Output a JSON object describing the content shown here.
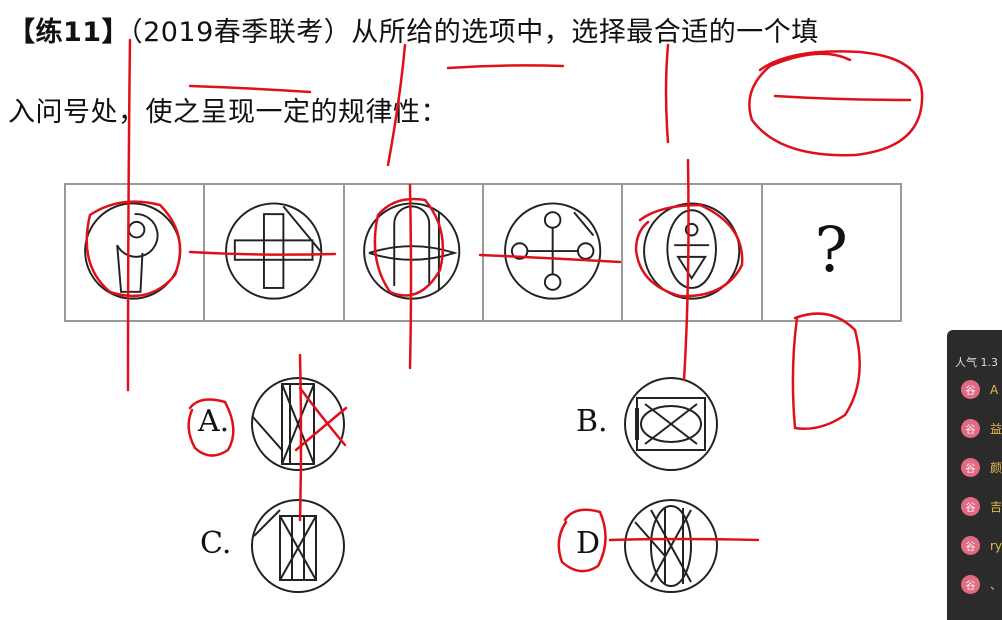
{
  "question": {
    "tag": "【练11】",
    "source": "（2019春季联考）",
    "line1_rest": "从所给的选项中，选择最合适的一个填",
    "line2": "入问号处，使之呈现一定的规律性："
  },
  "strip": {
    "question_mark": "?"
  },
  "options": {
    "a_label": "A.",
    "b_label": "B.",
    "c_label": "C.",
    "d_label": "D"
  },
  "chat": {
    "header": "人气 1.3",
    "items": [
      {
        "avatar": "谷",
        "text": "A"
      },
      {
        "avatar": "谷",
        "text": "益"
      },
      {
        "avatar": "谷",
        "text": "颜"
      },
      {
        "avatar": "谷",
        "text": "吉"
      },
      {
        "avatar": "谷",
        "text": "ry"
      },
      {
        "avatar": "谷",
        "text": "、"
      }
    ]
  },
  "colors": {
    "ink": "#e0101b",
    "figure": "#222222",
    "border": "#999999"
  }
}
